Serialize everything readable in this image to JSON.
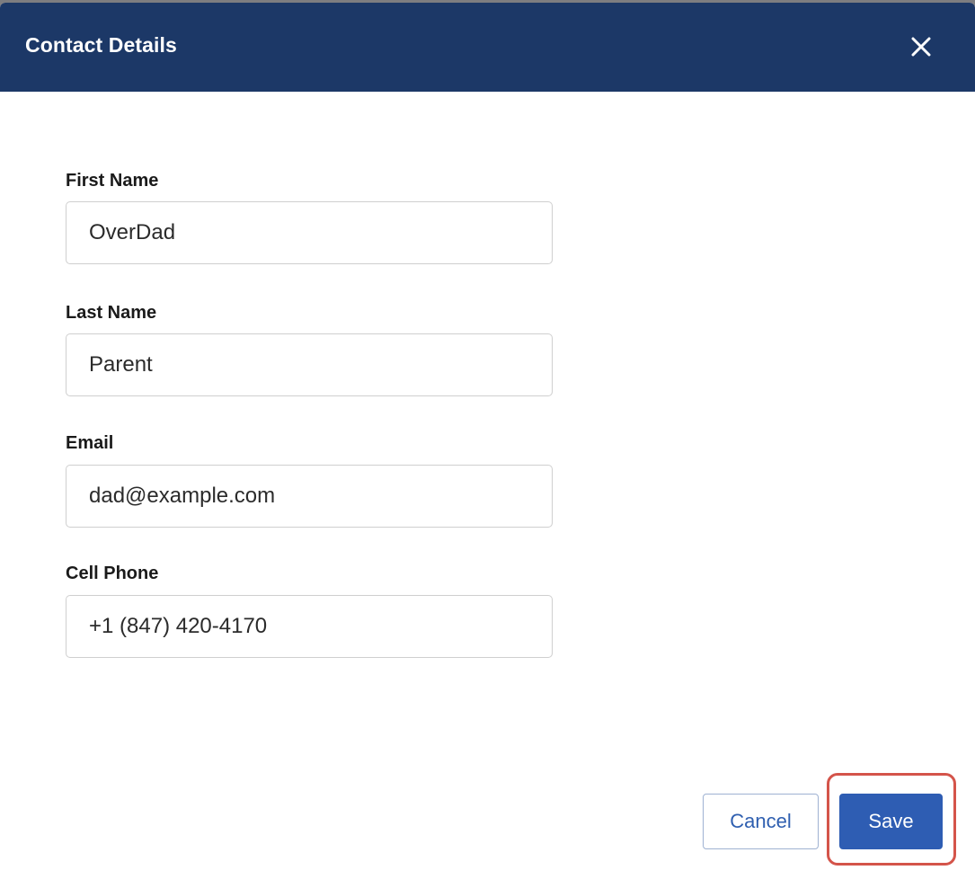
{
  "dialog": {
    "title": "Contact Details",
    "close_icon": "close-icon",
    "colors": {
      "header": "#1c3867",
      "primary": "#2e5db3",
      "highlight": "#d4544a"
    }
  },
  "form": {
    "first_name": {
      "label": "First Name",
      "value": "OverDad"
    },
    "last_name": {
      "label": "Last Name",
      "value": "Parent"
    },
    "email": {
      "label": "Email",
      "value": "dad@example.com"
    },
    "cell_phone": {
      "label": "Cell Phone",
      "value": "+1 (847) 420-4170"
    }
  },
  "actions": {
    "cancel_label": "Cancel",
    "save_label": "Save"
  }
}
